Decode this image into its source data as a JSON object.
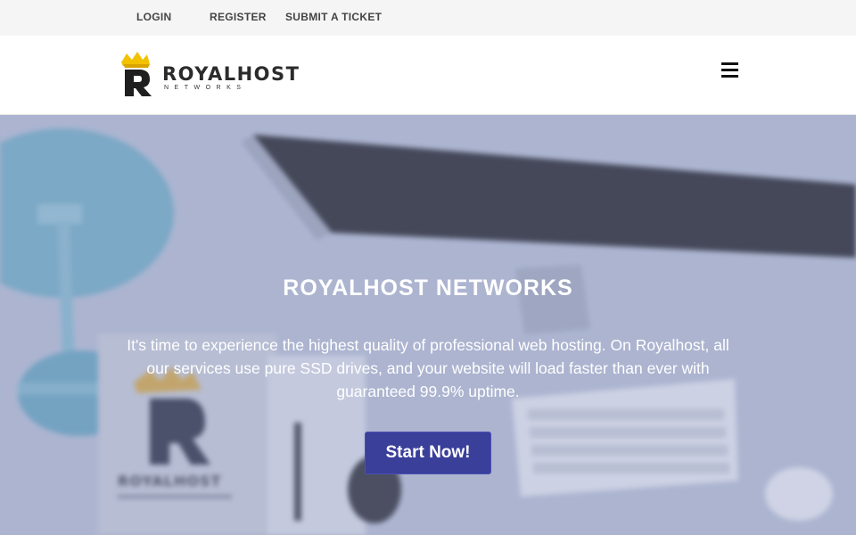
{
  "topbar": {
    "login": "LOGIN",
    "register": "REGISTER",
    "submit_ticket": "SUBMIT A TICKET"
  },
  "header": {
    "logo_name": "ROYALHOST",
    "logo_tagline": "NETWORKS",
    "menu_icon": "hamburger-menu-icon"
  },
  "hero": {
    "title": "ROYALHOST NETWORKS",
    "description": "It's time to experience the highest quality of professional web hosting. On Royalhost, all our services use pure SSD drives, and your website will load faster than ever with guaranteed 99.9% uptime.",
    "cta_label": "Start Now!",
    "background_mockup_text": "ROYALHOST"
  },
  "colors": {
    "accent": "#3a3f9a",
    "topbar_bg": "#f5f5f5",
    "hero_tint": "#aeb8cf"
  }
}
